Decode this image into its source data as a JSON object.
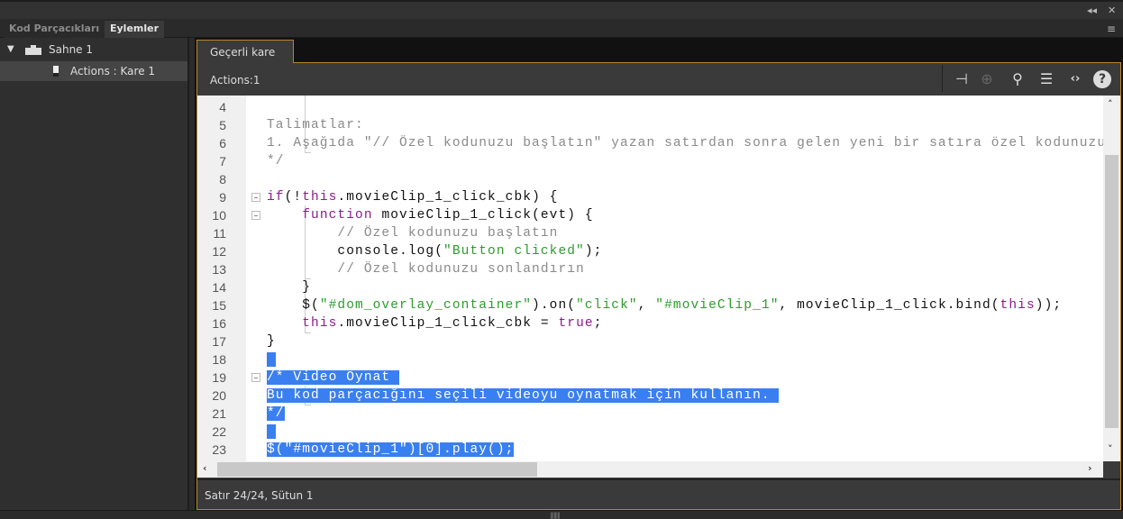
{
  "window": {
    "collapse_label": "◂◂",
    "close_label": "✕",
    "menu_label": "≡"
  },
  "panel_tabs": [
    {
      "label": "Kod Parçacıkları",
      "active": false
    },
    {
      "label": "Eylemler",
      "active": true
    }
  ],
  "tree": {
    "scene": "Sahne 1",
    "item": "Actions : Kare 1"
  },
  "doc_tab": "Geçerli kare",
  "toolbar": {
    "title": "Actions:1",
    "icons": [
      "pin-icon",
      "target-icon",
      "search-icon",
      "format-icon",
      "code-icon",
      "help-icon"
    ]
  },
  "code_lines": [
    {
      "n": "4",
      "t": []
    },
    {
      "n": "5",
      "t": [
        [
          "c",
          "Talimatlar:"
        ]
      ]
    },
    {
      "n": "6",
      "t": [
        [
          "c",
          "1. Aşağıda \"// Özel kodunuzu başlatın\" yazan satırdan sonra gelen yeni bir satıra özel kodunuzu"
        ]
      ]
    },
    {
      "n": "7",
      "t": [
        [
          "c",
          "*/"
        ]
      ]
    },
    {
      "n": "8",
      "t": []
    },
    {
      "n": "9",
      "t": [
        [
          "k",
          "if"
        ],
        [
          "d",
          "(!"
        ],
        [
          "k",
          "this"
        ],
        [
          "d",
          ".movieClip_1_click_cbk) {"
        ]
      ]
    },
    {
      "n": "10",
      "t": [
        [
          "d",
          "    "
        ],
        [
          "k",
          "function"
        ],
        [
          "d",
          " movieClip_1_click(evt) {"
        ]
      ]
    },
    {
      "n": "11",
      "t": [
        [
          "c",
          "        // Özel kodunuzu başlatın"
        ]
      ]
    },
    {
      "n": "12",
      "t": [
        [
          "d",
          "        console.log("
        ],
        [
          "s",
          "\"Button clicked\""
        ],
        [
          "d",
          ");"
        ]
      ]
    },
    {
      "n": "13",
      "t": [
        [
          "c",
          "        // Özel kodunuzu sonlandırın"
        ]
      ]
    },
    {
      "n": "14",
      "t": [
        [
          "d",
          "    }"
        ]
      ]
    },
    {
      "n": "15",
      "t": [
        [
          "d",
          "    $("
        ],
        [
          "s",
          "\"#dom_overlay_container\""
        ],
        [
          "d",
          ").on("
        ],
        [
          "s",
          "\"click\""
        ],
        [
          "d",
          ", "
        ],
        [
          "s",
          "\"#movieClip_1\""
        ],
        [
          "d",
          ", movieClip_1_click.bind("
        ],
        [
          "k",
          "this"
        ],
        [
          "d",
          "));"
        ]
      ]
    },
    {
      "n": "16",
      "t": [
        [
          "d",
          "    "
        ],
        [
          "k",
          "this"
        ],
        [
          "d",
          ".movieClip_1_click_cbk = "
        ],
        [
          "k",
          "true"
        ],
        [
          "d",
          ";"
        ]
      ]
    },
    {
      "n": "17",
      "t": [
        [
          "d",
          "}"
        ]
      ]
    },
    {
      "n": "18",
      "sel": true,
      "t": [
        [
          "d",
          " "
        ]
      ]
    },
    {
      "n": "19",
      "sel": true,
      "t": [
        [
          "c",
          "/* Video Oynat "
        ]
      ]
    },
    {
      "n": "20",
      "sel": true,
      "t": [
        [
          "c",
          "Bu kod parçacığını seçili videoyu oynatmak için kullanın. "
        ]
      ]
    },
    {
      "n": "21",
      "sel": true,
      "t": [
        [
          "c",
          "*/"
        ]
      ]
    },
    {
      "n": "22",
      "sel": true,
      "t": [
        [
          "d",
          " "
        ]
      ]
    },
    {
      "n": "23",
      "sel": true,
      "t": [
        [
          "d",
          "$("
        ],
        [
          "s",
          "\"#movieClip_1\""
        ],
        [
          "d",
          ")[0].play();"
        ]
      ]
    }
  ],
  "status": "Satır 24/24, Sütun 1",
  "colors": {
    "accent": "#b8862a",
    "selection": "#3a7ff0",
    "keyword": "#8b1b8b",
    "string": "#2e9a2e",
    "comment": "#8a8a8a"
  }
}
